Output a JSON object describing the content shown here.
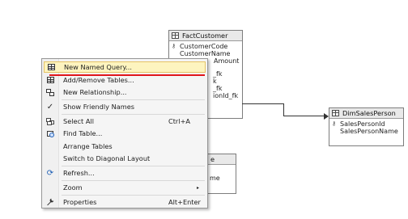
{
  "tables": {
    "fact_customer": {
      "title": "FactCustomer",
      "columns": [
        {
          "name": "CustomerCode",
          "pk": true
        },
        {
          "name": "CustomerName",
          "pk": false
        },
        {
          "name": "Amount",
          "pk": false
        },
        {
          "name": "_fk",
          "pk": false
        },
        {
          "name": "k",
          "pk": false
        },
        {
          "name": "_fk",
          "pk": false
        },
        {
          "name": "ionId_fk",
          "pk": false
        }
      ]
    },
    "dim_sales_person": {
      "title": "DimSalesPerson",
      "columns": [
        {
          "name": "SalesPersonId",
          "pk": true
        },
        {
          "name": "SalesPersonName",
          "pk": false
        }
      ]
    },
    "hidden_table": {
      "title": "e",
      "columns": [
        {
          "name": "me",
          "pk": false
        }
      ]
    }
  },
  "context_menu": {
    "items": [
      {
        "label": "New Named Query...",
        "shortcut": "",
        "icon": "new-query-icon"
      },
      {
        "label": "Add/Remove Tables...",
        "shortcut": "",
        "icon": "add-remove-tables-icon"
      },
      {
        "label": "New Relationship...",
        "shortcut": "",
        "icon": "new-relationship-icon"
      },
      {
        "label": "Show Friendly Names",
        "shortcut": "",
        "icon": "checkmark-icon"
      },
      {
        "label": "Select All",
        "shortcut": "Ctrl+A",
        "icon": "select-all-icon"
      },
      {
        "label": "Find Table...",
        "shortcut": "",
        "icon": "find-table-icon"
      },
      {
        "label": "Arrange Tables",
        "shortcut": "",
        "icon": ""
      },
      {
        "label": "Switch to Diagonal Layout",
        "shortcut": "",
        "icon": ""
      },
      {
        "label": "Refresh...",
        "shortcut": "",
        "icon": "refresh-icon"
      },
      {
        "label": "Zoom",
        "shortcut": "",
        "icon": "",
        "submenu_arrow": "▸"
      },
      {
        "label": "Properties",
        "shortcut": "Alt+Enter",
        "icon": "wrench-icon"
      }
    ],
    "icons": {
      "check": "✓",
      "refresh": "⟳",
      "wrench": "🔧"
    }
  },
  "colors": {
    "highlight_bg": "#fdf4bf",
    "highlight_border": "#e5c365",
    "annotation_underline": "#e0161c"
  }
}
